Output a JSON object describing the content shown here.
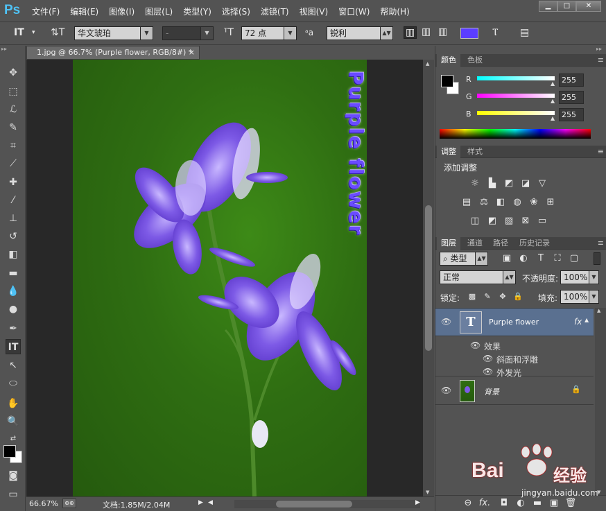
{
  "app": {
    "logo": "Ps"
  },
  "menu": [
    "文件(F)",
    "编辑(E)",
    "图像(I)",
    "图层(L)",
    "类型(Y)",
    "选择(S)",
    "滤镜(T)",
    "视图(V)",
    "窗口(W)",
    "帮助(H)"
  ],
  "window_controls": {
    "minimize": "▁",
    "maximize": "□",
    "close": "✕"
  },
  "options": {
    "font_family": "华文琥珀",
    "font_style": "-",
    "font_size": "72 点",
    "antialias": "锐利",
    "color": "#5b3dff"
  },
  "document": {
    "tab_title": "1.jpg @ 66.7% (Purple flower, RGB/8#) *",
    "text_layer_content": "Purple flower"
  },
  "status": {
    "zoom": "66.67%",
    "doc_info": "文档:1.85M/2.04M"
  },
  "color_panel": {
    "tabs": [
      "颜色",
      "色板"
    ],
    "channels": [
      {
        "label": "R",
        "value": "255"
      },
      {
        "label": "G",
        "value": "255"
      },
      {
        "label": "B",
        "value": "255"
      }
    ]
  },
  "adjust_panel": {
    "tabs": [
      "调整",
      "样式"
    ],
    "title": "添加调整"
  },
  "layers_panel": {
    "tabs": [
      "图层",
      "通道",
      "路径",
      "历史记录"
    ],
    "filter_kind": "类型",
    "blend_mode": "正常",
    "opacity_label": "不透明度:",
    "opacity_value": "100%",
    "lock_label": "锁定:",
    "fill_label": "填充:",
    "fill_value": "100%",
    "layers": [
      {
        "name": "Purple flower",
        "fx": "fx"
      },
      {
        "name": "背景"
      }
    ],
    "effects_label": "效果",
    "effects": [
      "斜面和浮雕",
      "外发光"
    ]
  },
  "watermark": {
    "brand": "Bai",
    "brand2": "经验",
    "url": "jingyan.baidu.com"
  }
}
